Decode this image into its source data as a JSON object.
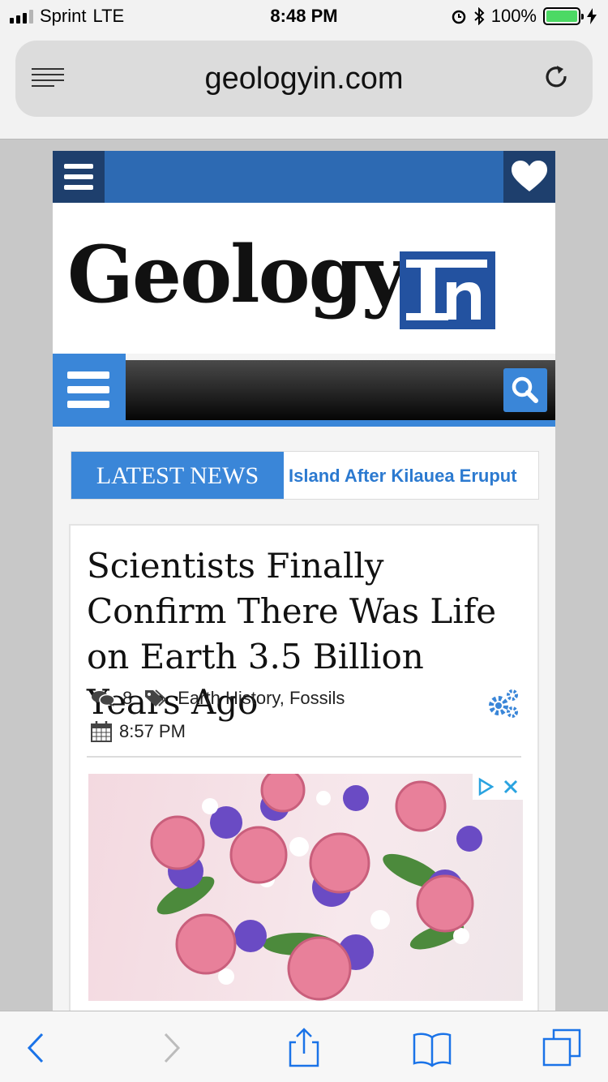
{
  "status": {
    "carrier": "Sprint",
    "network": "LTE",
    "time": "8:48 PM",
    "battery": "100%"
  },
  "browser": {
    "url": "geologyin.com"
  },
  "site": {
    "logo_word": "Geology",
    "logo_badge": "In",
    "ticker_label": "LATEST NEWS",
    "ticker_headline": "Island After Kilauea Eruput"
  },
  "article": {
    "title": "Scientists Finally Confirm There Was Life on Earth 3.5 Billion Years Ago",
    "comments": "8",
    "tags": "Earth History, Fossils",
    "time": "8:57 PM"
  },
  "colors": {
    "site_blue": "#2d6ab3",
    "accent_blue": "#3a86d8",
    "dark_blue": "#1e3f6d",
    "ios_blue": "#1a73e8"
  }
}
